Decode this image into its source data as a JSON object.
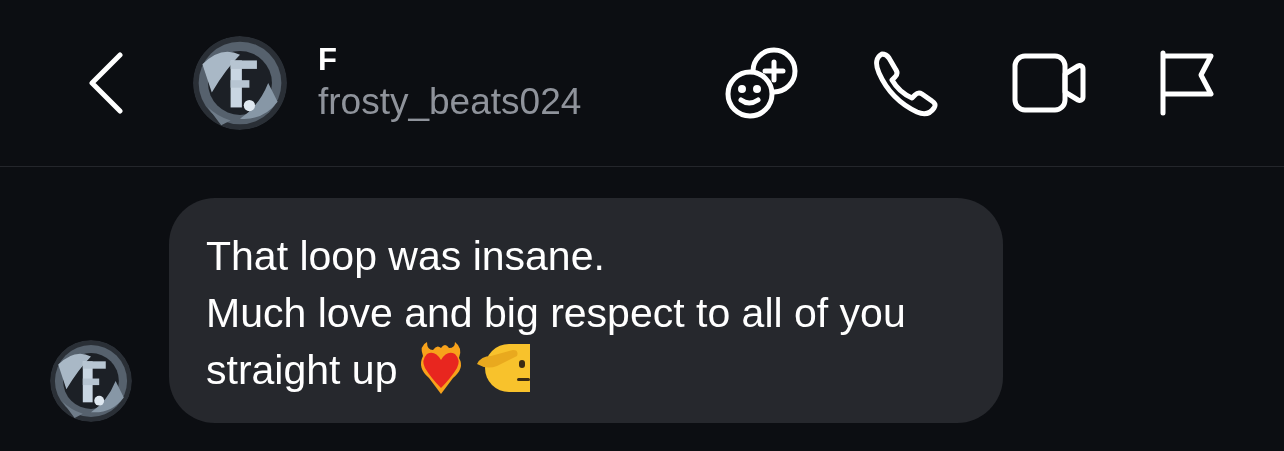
{
  "header": {
    "name": "F",
    "username": "frosty_beats024"
  },
  "messages": [
    {
      "lines": [
        "That loop was insane.",
        "Much love and big respect to all of you",
        "straight up"
      ]
    }
  ]
}
